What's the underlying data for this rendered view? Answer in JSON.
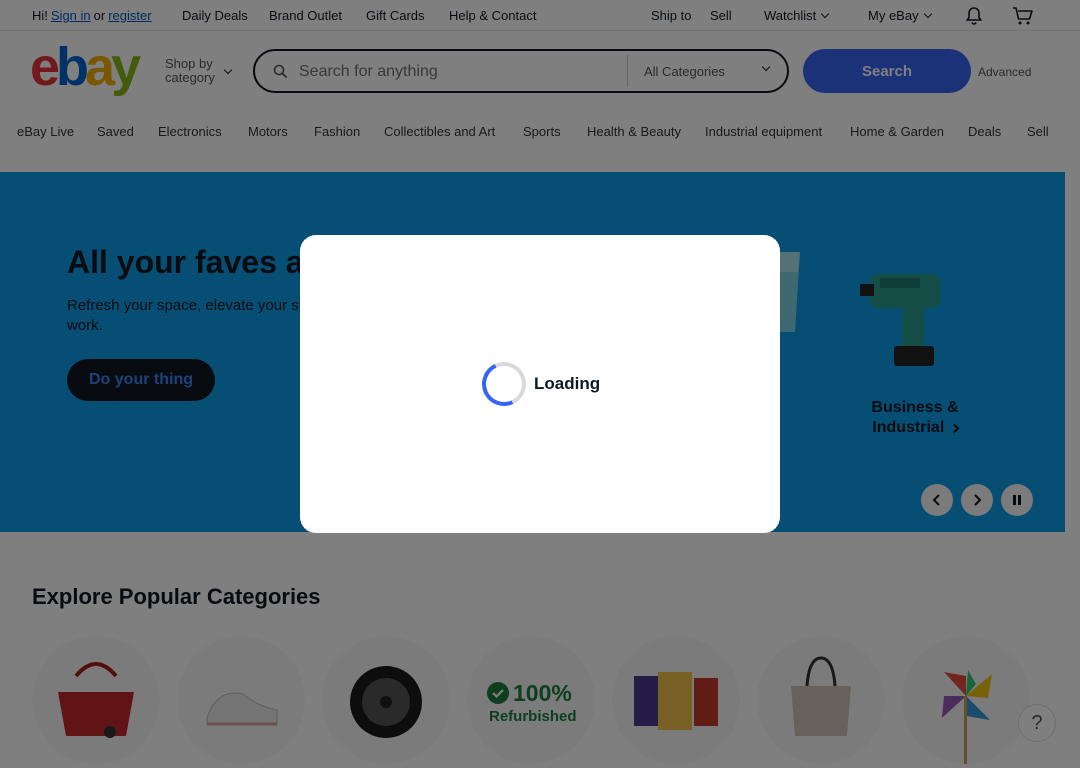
{
  "topbar": {
    "greeting": "Hi!",
    "sign_in": "Sign in",
    "or": "or",
    "register": "register",
    "nav": [
      "Daily Deals",
      "Brand Outlet",
      "Gift Cards",
      "Help & Contact"
    ],
    "ship_to": "Ship to",
    "sell": "Sell",
    "watchlist": "Watchlist",
    "my_ebay": "My eBay"
  },
  "header": {
    "logo": [
      "e",
      "b",
      "a",
      "y"
    ],
    "shop_by": "Shop by",
    "category": "category",
    "search_placeholder": "Search for anything",
    "category_select": "All Categories",
    "search_button": "Search",
    "advanced": "Advanced"
  },
  "catnav": [
    "eBay Live",
    "Saved",
    "Electronics",
    "Motors",
    "Fashion",
    "Collectibles and Art",
    "Sports",
    "Health & Beauty",
    "Industrial equipment",
    "Home & Garden",
    "Deals",
    "Sell"
  ],
  "hero": {
    "title": "All your faves ar",
    "subtitle": "Refresh your space, elevate your st work.",
    "cta": "Do your thing",
    "tile_label_1": "Business &",
    "tile_label_2": "Industrial"
  },
  "explore": {
    "title": "Explore Popular Categories",
    "refurbished_pct": "100%",
    "refurbished_label": "Refurbished"
  },
  "help": "?",
  "modal": {
    "loading": "Loading"
  },
  "colors": {
    "brand_blue": "#3665f3",
    "hero_bg": "#0d9ce9",
    "logo_red": "#e53238",
    "logo_blue": "#0064d2",
    "logo_yellow": "#f5af02",
    "logo_green": "#86b817"
  }
}
